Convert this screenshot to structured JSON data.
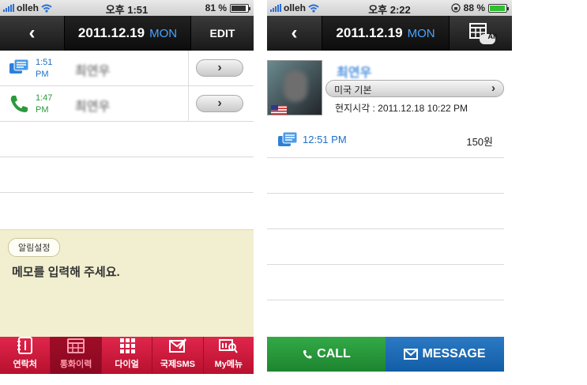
{
  "left": {
    "status": {
      "carrier": "olleh",
      "time": "오후 1:51",
      "battery": "81 %"
    },
    "header": {
      "back": "‹",
      "date": "2011.12.19",
      "weekday": "MON",
      "edit": "EDIT"
    },
    "calls": [
      {
        "type": "sms",
        "time_line1": "1:51",
        "time_line2": "PM",
        "name": "최연우",
        "arrow": "›"
      },
      {
        "type": "voice",
        "time_line1": "1:47",
        "time_line2": "PM",
        "name": "최연우",
        "arrow": "›"
      }
    ],
    "memo": {
      "chip": "알림설정",
      "placeholder": "메모를 입력해 주세요."
    },
    "tabs": [
      {
        "label": "연락처",
        "icon": "contacts-icon"
      },
      {
        "label": "통화이력",
        "icon": "call-history-icon"
      },
      {
        "label": "다이얼",
        "icon": "dialpad-icon"
      },
      {
        "label": "국제SMS",
        "icon": "sms-icon"
      },
      {
        "label": "My메뉴",
        "icon": "my-menu-icon"
      }
    ]
  },
  "right": {
    "status": {
      "carrier": "olleh",
      "time": "오후 2:22",
      "battery": "88 %"
    },
    "header": {
      "back": "‹",
      "date": "2011.12.19",
      "weekday": "MON",
      "all_badge": "All"
    },
    "contact": {
      "name": "최연우",
      "plan": "미국 기본",
      "plan_arrow": "›",
      "local_time": "현지시각 : 2011.12.18 10:22 PM"
    },
    "sms": {
      "time": "12:51 PM",
      "cost": "150원"
    },
    "actions": {
      "call": "CALL",
      "message": "MESSAGE"
    }
  },
  "colors": {
    "accent_blue": "#4aa3ff",
    "tab_red": "#d81b40",
    "call_green": "#2a9a3c",
    "message_blue": "#1f6bb6",
    "memo_bg": "#f1efcf"
  }
}
